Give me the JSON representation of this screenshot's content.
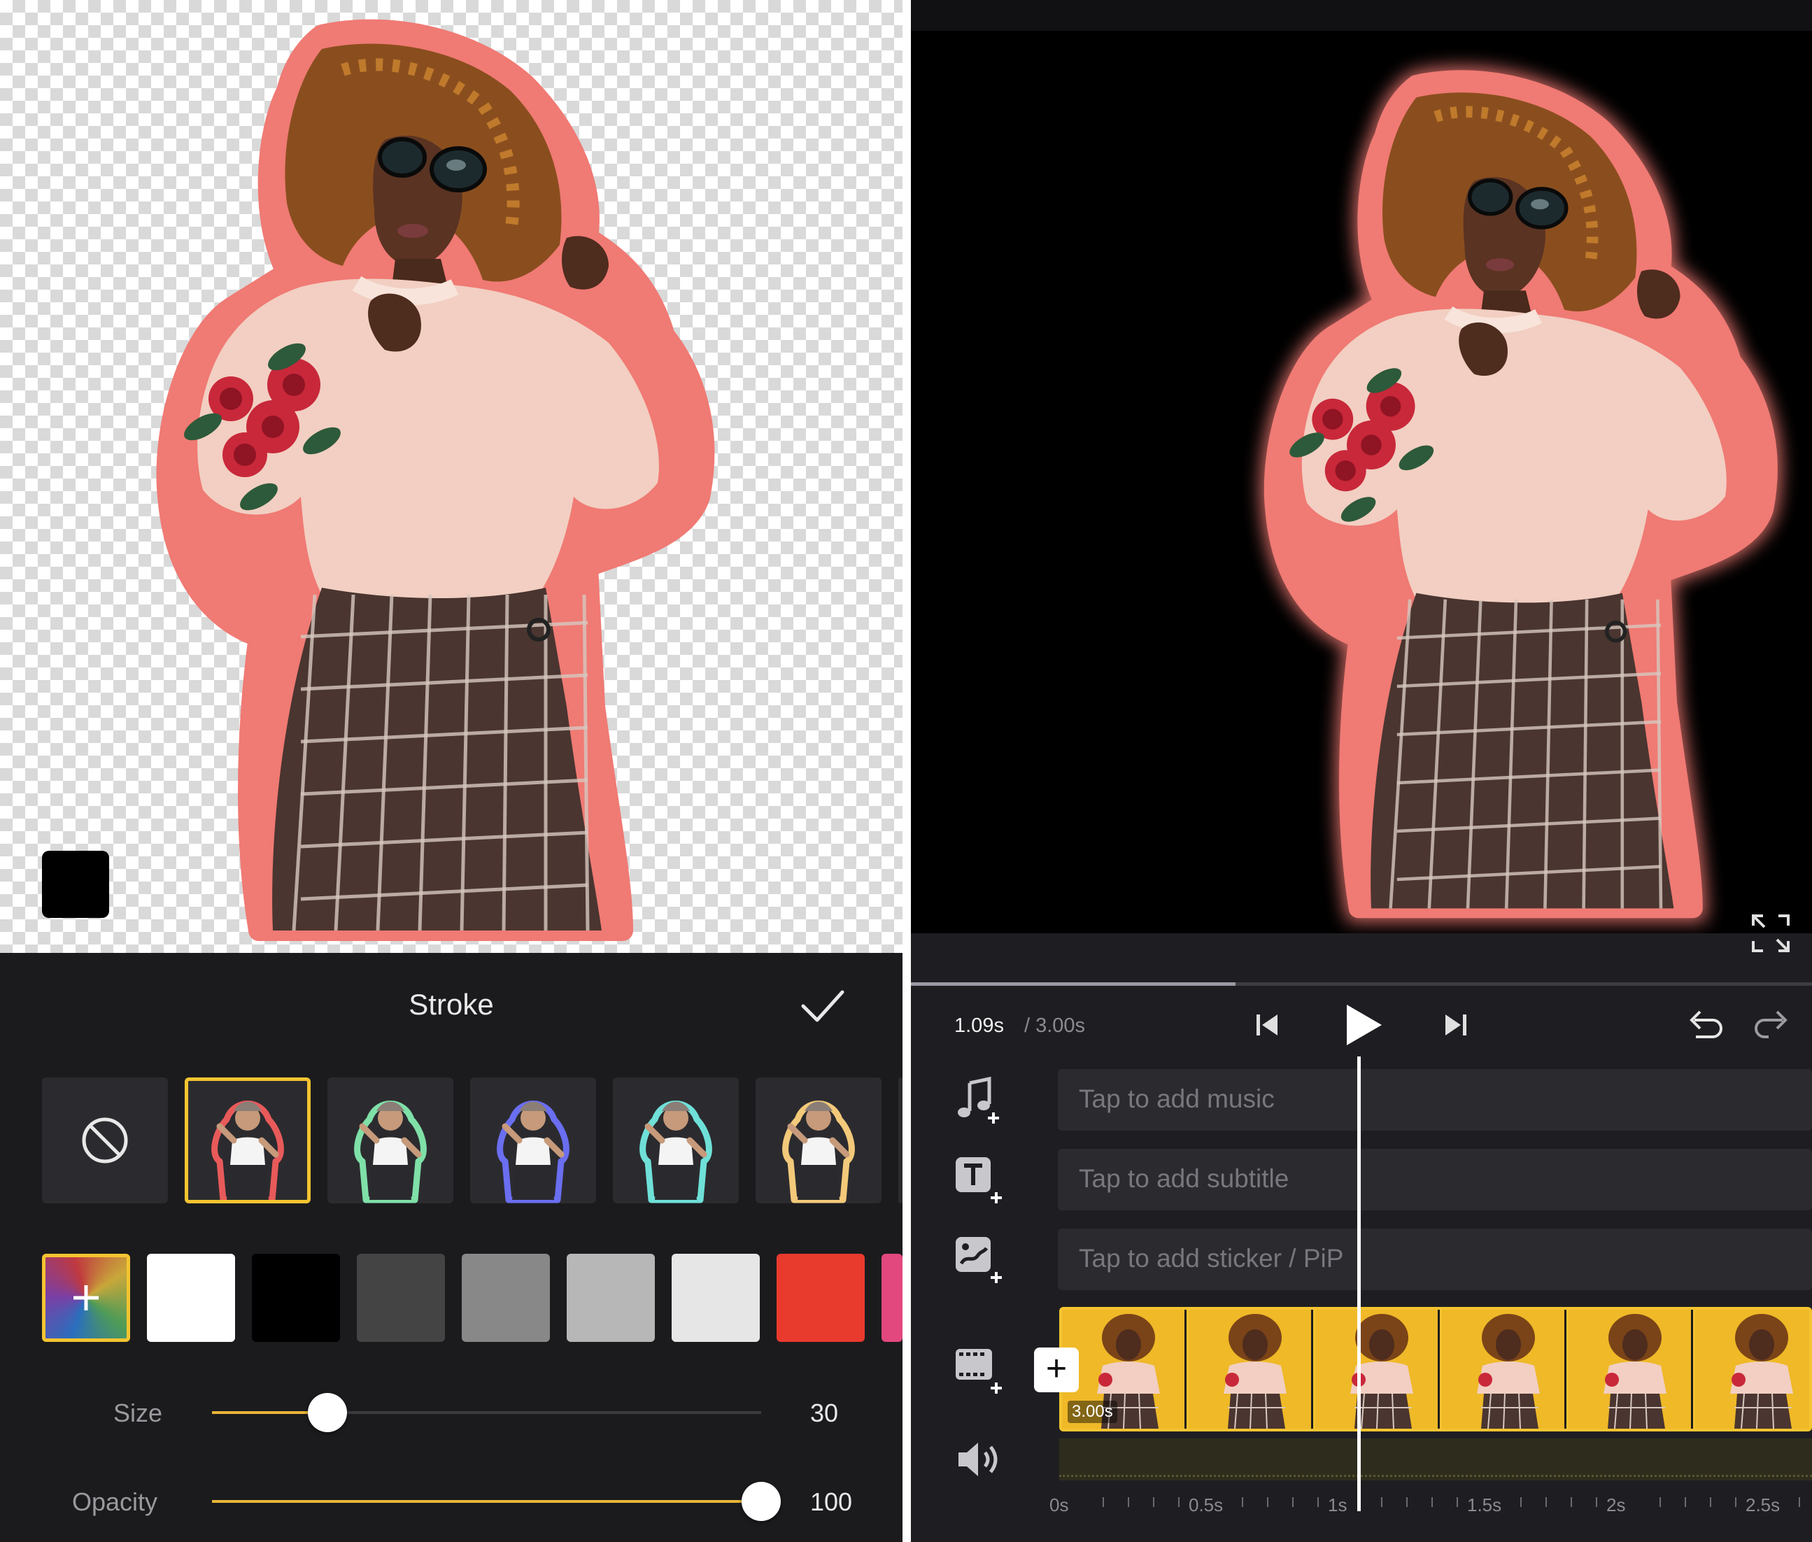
{
  "stroke_panel": {
    "title": "Stroke",
    "presets": [
      {
        "name": "none"
      },
      {
        "name": "red-stroke",
        "color": "#e85a5a",
        "selected": true
      },
      {
        "name": "green-stroke",
        "color": "#7fe0a8"
      },
      {
        "name": "blue-stroke",
        "color": "#6a6ef0"
      },
      {
        "name": "teal-glow",
        "color": "#6fe0d8"
      },
      {
        "name": "gold-glow",
        "color": "#f3c97a"
      }
    ],
    "colors": [
      "custom",
      "#ffffff",
      "#000000",
      "#444444",
      "#888888",
      "#b7b7b7",
      "#e6e6e6",
      "#e93a2e",
      "#e2487d"
    ],
    "accent_color": "#f4c430",
    "size": {
      "label": "Size",
      "value": "30",
      "fraction": 0.21
    },
    "opacity": {
      "label": "Opacity",
      "value": "100",
      "fraction": 1.0
    },
    "background_color": "#000000"
  },
  "editor": {
    "time_current": "1.09s",
    "time_total": "/ 3.00s",
    "progress_fraction": 0.36,
    "tracks": {
      "music": "Tap to add music",
      "subtitle": "Tap to add subtitle",
      "sticker": "Tap to add sticker / PiP"
    },
    "clip_duration": "3.00s",
    "ruler": [
      "0s",
      "0.5s",
      "1s",
      "1.5s",
      "2s",
      "2.5s"
    ],
    "stroke_color": "#f07a74"
  }
}
